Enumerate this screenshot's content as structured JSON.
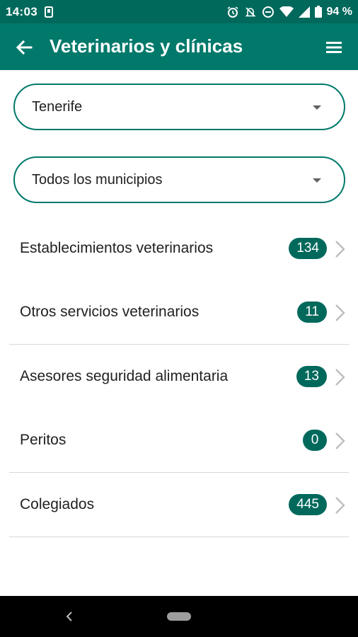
{
  "status_bar": {
    "time": "14:03",
    "battery": "94 %"
  },
  "app_bar": {
    "title": "Veterinarios y clínicas",
    "back_icon": "arrow-left-icon",
    "menu_icon": "hamburger-menu-icon"
  },
  "filters": {
    "island": "Tenerife",
    "municipality": "Todos los municipios"
  },
  "list": {
    "items": [
      {
        "label": "Establecimientos veterinarios",
        "count": "134"
      },
      {
        "label": "Otros servicios veterinarios",
        "count": "11"
      },
      {
        "label": "Asesores seguridad alimentaria",
        "count": "13"
      },
      {
        "label": "Peritos",
        "count": "0"
      },
      {
        "label": "Colegiados",
        "count": "445"
      }
    ]
  },
  "colors": {
    "primary": "#00796b",
    "primary_dark": "#00695c",
    "badge": "#00695c"
  }
}
